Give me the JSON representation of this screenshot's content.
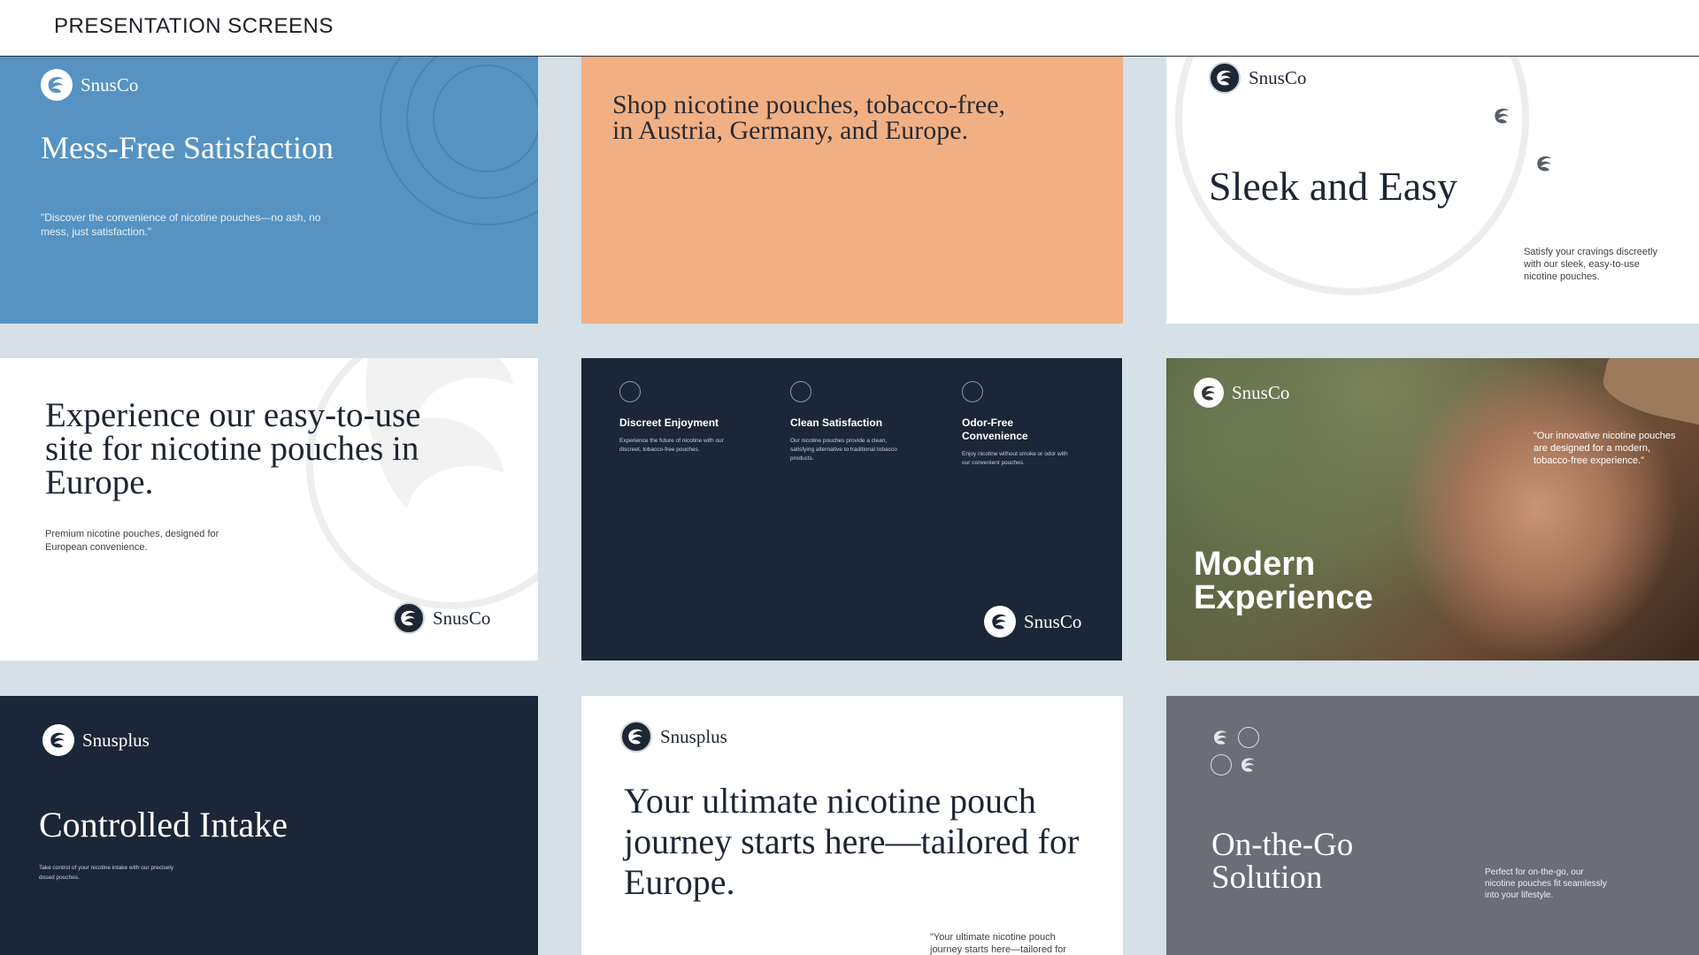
{
  "page": {
    "title": "PRESENTATION SCREENS"
  },
  "slides": {
    "s1": {
      "logo": "SnusCo",
      "headline": "Mess-Free Satisfaction",
      "body": "\"Discover the convenience of nicotine pouches—no ash, no mess, just satisfaction.\"",
      "bg": "#5693c2"
    },
    "s2": {
      "headline": "Shop nicotine pouches, tobacco-free, in Austria, Germany, and Europe.",
      "bg": "#f1b084"
    },
    "s3": {
      "logo": "SnusCo",
      "headline": "Sleek and Easy",
      "body": "Satisfy your cravings discreetly with our sleek, easy-to-use nicotine pouches."
    },
    "s4": {
      "headline": "Experience our easy-to-use site for nicotine pouches in Europe.",
      "body": "Premium nicotine pouches, designed for European convenience.",
      "logo": "SnusCo"
    },
    "s5": {
      "features": [
        {
          "title": "Discreet Enjoyment",
          "desc": "Experience the future of nicotine with our discreet, tobacco-free pouches."
        },
        {
          "title": "Clean Satisfaction",
          "desc": "Our nicotine pouches provide a clean, satisfying alternative to traditional tobacco products."
        },
        {
          "title": "Odor-Free Convenience",
          "desc": "Enjoy nicotine without smoke or odor with our convenient pouches."
        }
      ],
      "logo": "SnusCo",
      "bg": "#1b2738"
    },
    "s6": {
      "logo": "SnusCo",
      "quote": "\"Our innovative nicotine pouches are designed for a modern, tobacco-free experience.\"",
      "headline": "Modern Experience"
    },
    "s7": {
      "logo": "Snusplus",
      "headline": "Controlled Intake",
      "body": "Take control of your nicotine intake with our precisely dosed pouches."
    },
    "s8": {
      "logo": "Snusplus",
      "headline": "Your ultimate nicotine pouch journey starts here—tailored for Europe.",
      "quote": "\"Your ultimate nicotine pouch journey starts here—tailored for"
    },
    "s9": {
      "headline": "On-the-Go Solution",
      "body": "Perfect for on-the-go, our nicotine pouches fit seamlessly into your lifestyle.",
      "bg": "#6b6e78"
    }
  }
}
